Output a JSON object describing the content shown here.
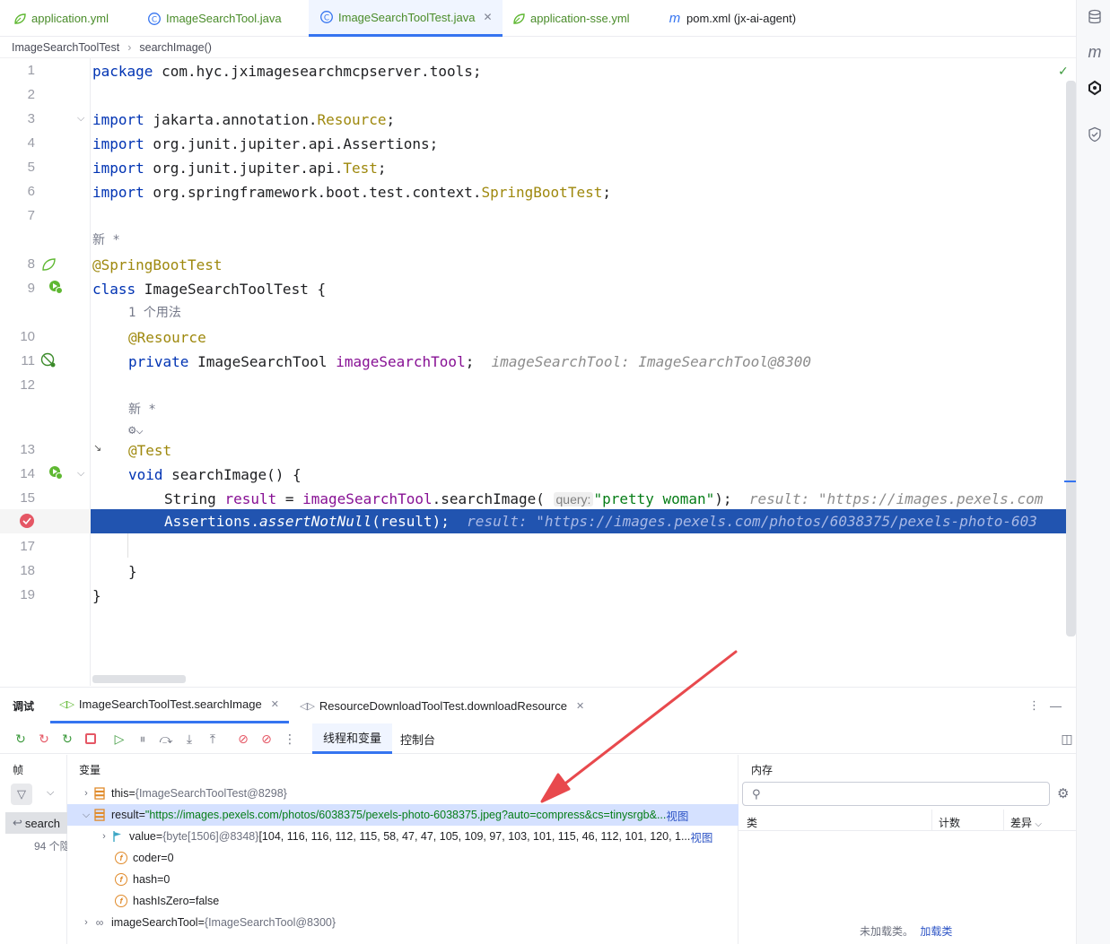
{
  "tabs": [
    {
      "label": "application.yml",
      "icon": "spring-yml-icon"
    },
    {
      "label": "ImageSearchTool.java",
      "icon": "java-class-icon"
    },
    {
      "label": "ImageSearchToolTest.java",
      "icon": "java-class-icon",
      "active": true
    },
    {
      "label": "application-sse.yml",
      "icon": "spring-yml-icon"
    },
    {
      "label": "pom.xml (jx-ai-agent)",
      "icon": "maven-icon"
    }
  ],
  "breadcrumb": [
    "ImageSearchToolTest",
    "searchImage()"
  ],
  "editor": {
    "line_numbers": [
      "1",
      "2",
      "3",
      "4",
      "5",
      "6",
      "7",
      "8",
      "9",
      "10",
      "11",
      "12",
      "13",
      "14",
      "15",
      "17",
      "18",
      "19"
    ],
    "hints": {
      "new_star": "新 *",
      "usages": "1 个用法"
    },
    "lines": {
      "l1_kw": "package",
      "l1_rest": " com.hyc.jximagesearchmcpserver.tools;",
      "import": "import",
      "l3_a": " jakarta.annotation.",
      "l3_b": "Resource",
      "l3_c": ";",
      "l4_a": " org.junit.jupiter.api.Assertions;",
      "l5_a": " org.junit.jupiter.api.",
      "l5_b": "Test",
      "l5_c": ";",
      "l6_a": " org.springframework.boot.test.context.",
      "l6_b": "SpringBootTest",
      "l6_c": ";",
      "l8": "@SpringBootTest",
      "l9_kw": "class",
      "l9_rest": " ImageSearchToolTest {",
      "l10": "@Resource",
      "l11_kw": "private",
      "l11_type": " ImageSearchTool ",
      "l11_fld": "imageSearchTool",
      "l11_semi": ";",
      "l11_inline": "imageSearchTool: ImageSearchTool@8300",
      "l13": "@Test",
      "l14_kw": "void",
      "l14_rest": " searchImage() {",
      "l15_a": "String ",
      "l15_var": "result",
      "l15_b": " = ",
      "l15_fld": "imageSearchTool",
      "l15_c": ".searchImage(",
      "l15_param": "query:",
      "l15_str": "\"pretty woman\"",
      "l15_d": ");",
      "l15_inline": "result: \"https://images.pexels.com",
      "l16_a": "Assertions.",
      "l16_m": "assertNotNull",
      "l16_b": "(result);",
      "l16_inline": "result: \"https://images.pexels.com/photos/6038375/pexels-photo-603",
      "l18": "}",
      "l19": "}"
    }
  },
  "debug": {
    "title": "调试",
    "sessions": [
      "ImageSearchToolTest.searchImage",
      "ResourceDownloadToolTest.downloadResource"
    ],
    "subtabs": [
      "线程和变量",
      "控制台"
    ],
    "frames_title": "帧",
    "frame_item": "search",
    "frame_hidden": "94 个隐",
    "vars_title": "变量",
    "vars": [
      {
        "name": "this",
        "eq": " = ",
        "meta": "{ImageSearchToolTest@8298}"
      },
      {
        "name": "result",
        "eq": " = ",
        "value": "\"https://images.pexels.com/photos/6038375/pexels-photo-6038375.jpeg?auto=compress&cs=tinysrgb&...",
        "link": "视图"
      },
      {
        "name": "value",
        "eq": " = ",
        "meta": "{byte[1506]@8348}",
        "value": " [104, 116, 116, 112, 115, 58, 47, 47, 105, 109, 97, 103, 101, 115, 46, 112, 101, 120, 1...",
        "link": "视图"
      },
      {
        "name": "coder",
        "eq": " = ",
        "value": "0"
      },
      {
        "name": "hash",
        "eq": " = ",
        "value": "0"
      },
      {
        "name": "hashIsZero",
        "eq": " = ",
        "value": "false"
      },
      {
        "name": "imageSearchTool",
        "eq": " = ",
        "meta": "{ImageSearchTool@8300}"
      }
    ],
    "memory": {
      "title": "内存",
      "search_placeholder": "",
      "cols": [
        "类",
        "计数",
        "差异"
      ],
      "status": "未加载类。",
      "load_link": "加载类"
    }
  },
  "colors": {
    "accent": "#3574f0",
    "selection": "#2154b0",
    "annotation": "#9e880d",
    "keyword": "#0033b3",
    "string": "#067d17",
    "field": "#871094",
    "arrow": "#e8494d"
  }
}
